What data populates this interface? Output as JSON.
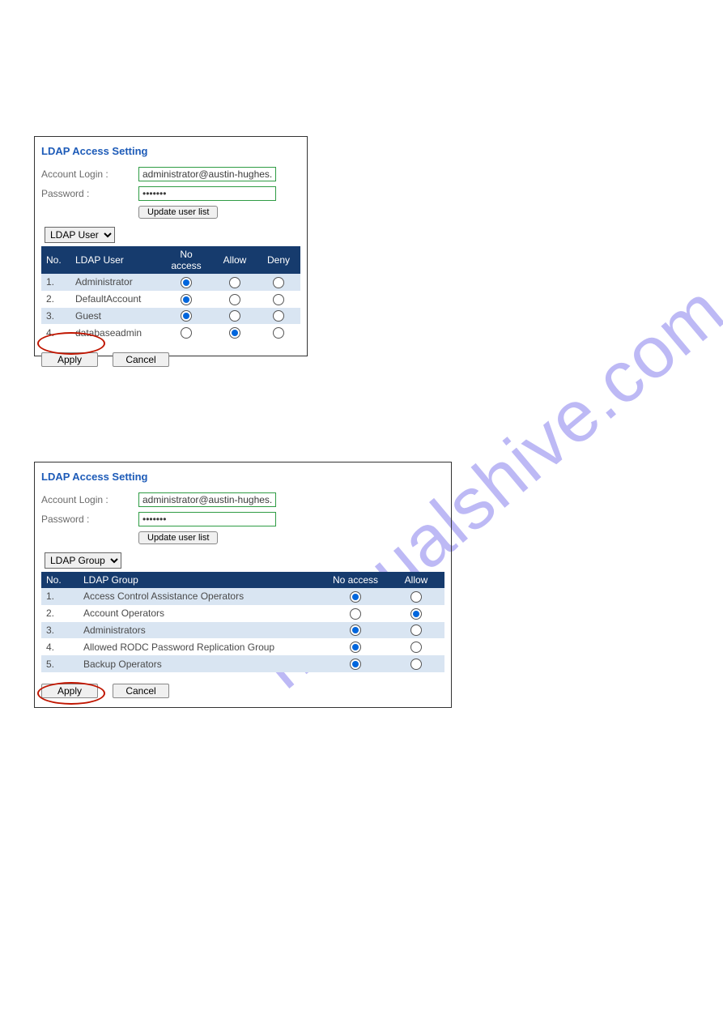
{
  "watermark": "manualshive.com",
  "panel1": {
    "title": "LDAP Access Setting",
    "account_login_label": "Account Login :",
    "account_login_value": "administrator@austin-hughes.dc",
    "password_label": "Password :",
    "password_value": "•••••••",
    "update_btn": "Update user list",
    "select_value": "LDAP User",
    "headers": {
      "no": "No.",
      "user": "LDAP User",
      "noaccess": "No access",
      "allow": "Allow",
      "deny": "Deny"
    },
    "rows": [
      {
        "no": "1.",
        "user": "Administrator",
        "sel": "noaccess"
      },
      {
        "no": "2.",
        "user": "DefaultAccount",
        "sel": "noaccess"
      },
      {
        "no": "3.",
        "user": "Guest",
        "sel": "noaccess"
      },
      {
        "no": "4.",
        "user": "databaseadmin",
        "sel": "allow"
      }
    ],
    "apply_btn": "Apply",
    "cancel_btn": "Cancel"
  },
  "panel2": {
    "title": "LDAP Access Setting",
    "account_login_label": "Account Login :",
    "account_login_value": "administrator@austin-hughes.dc",
    "password_label": "Password :",
    "password_value": "•••••••",
    "update_btn": "Update user list",
    "select_value": "LDAP Group",
    "headers": {
      "no": "No.",
      "group": "LDAP Group",
      "noaccess": "No access",
      "allow": "Allow"
    },
    "rows": [
      {
        "no": "1.",
        "group": "Access Control Assistance Operators",
        "sel": "noaccess"
      },
      {
        "no": "2.",
        "group": "Account Operators",
        "sel": "allow"
      },
      {
        "no": "3.",
        "group": "Administrators",
        "sel": "noaccess"
      },
      {
        "no": "4.",
        "group": "Allowed RODC Password Replication Group",
        "sel": "noaccess"
      },
      {
        "no": "5.",
        "group": "Backup Operators",
        "sel": "noaccess"
      }
    ],
    "apply_btn": "Apply",
    "cancel_btn": "Cancel"
  }
}
